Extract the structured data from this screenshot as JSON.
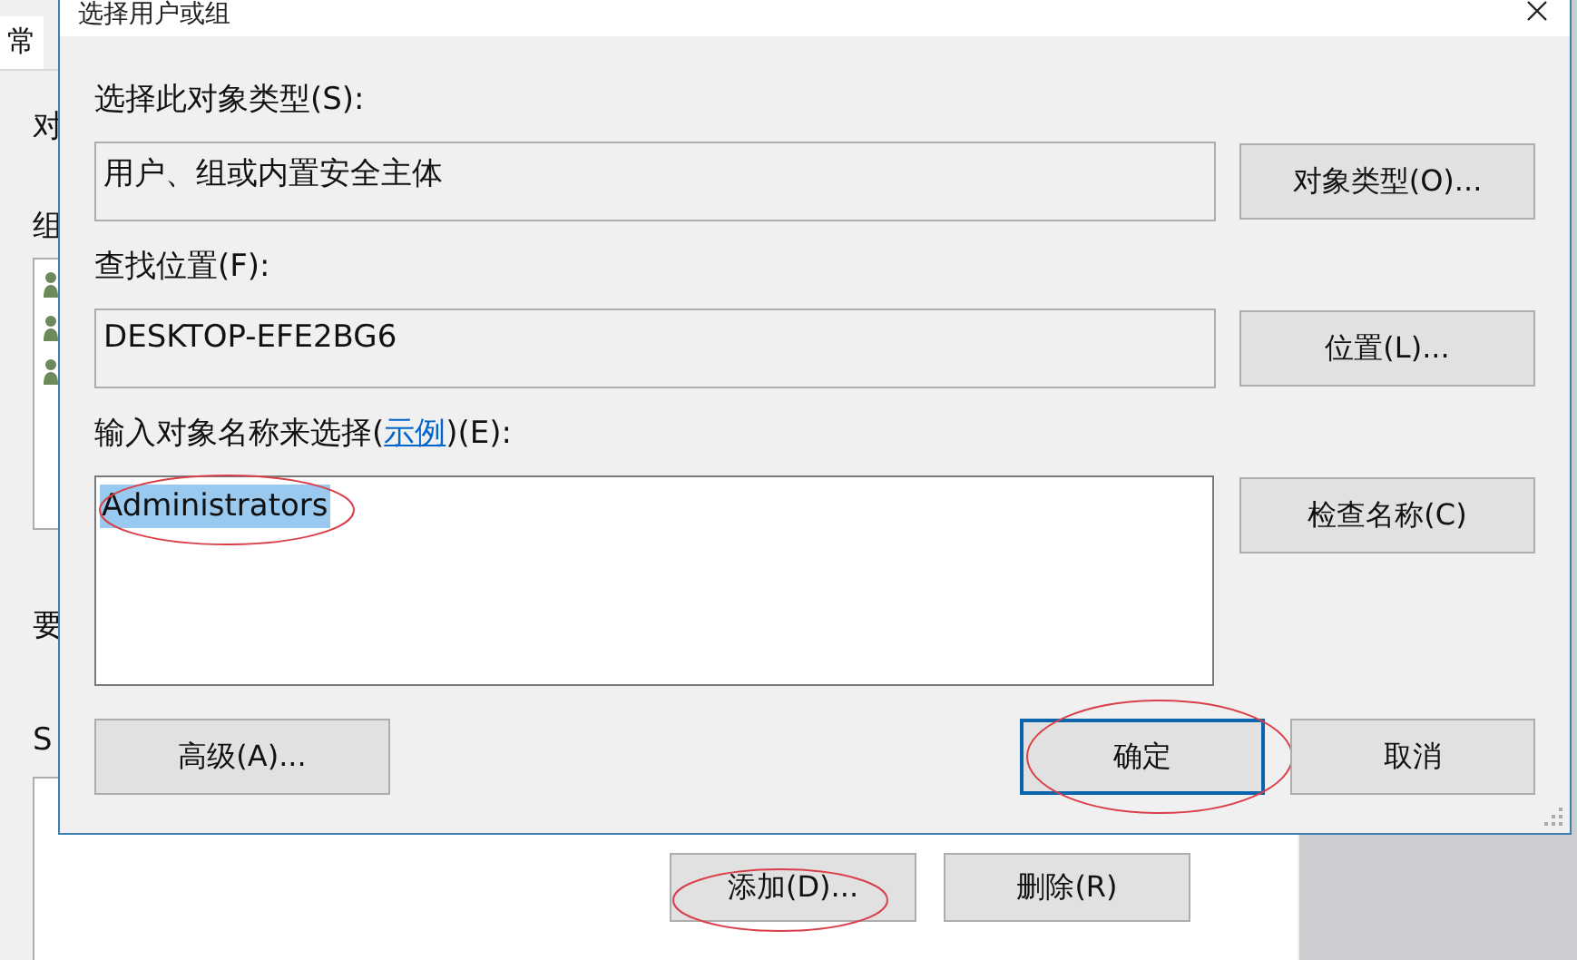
{
  "background_window": {
    "tab": "常",
    "labels": [
      "对",
      "组",
      "要",
      "S"
    ],
    "buttons": [
      {
        "label": "添加(D)...",
        "circled": true
      },
      {
        "label": "删除(R)",
        "circled": false
      }
    ]
  },
  "dialog": {
    "title": "选择用户或组",
    "object_type": {
      "label": "选择此对象类型(S):",
      "value": "用户、组或内置安全主体",
      "button": "对象类型(O)..."
    },
    "location": {
      "label": "查找位置(F):",
      "value": "DESKTOP-EFE2BG6",
      "button": "位置(L)..."
    },
    "names": {
      "label_before": "输入对象名称来选择(",
      "link": "示例",
      "label_after": ")(E):",
      "value": "Administrators",
      "value_selected": true,
      "circled": true,
      "button": "检查名称(C)"
    },
    "buttons": [
      {
        "label": "高级(A)...",
        "kind": "left",
        "focused": false,
        "circled": false
      },
      {
        "label": "确定",
        "kind": "right",
        "focused": true,
        "circled": true
      },
      {
        "label": "取消",
        "kind": "right",
        "focused": false,
        "circled": false
      }
    ]
  }
}
